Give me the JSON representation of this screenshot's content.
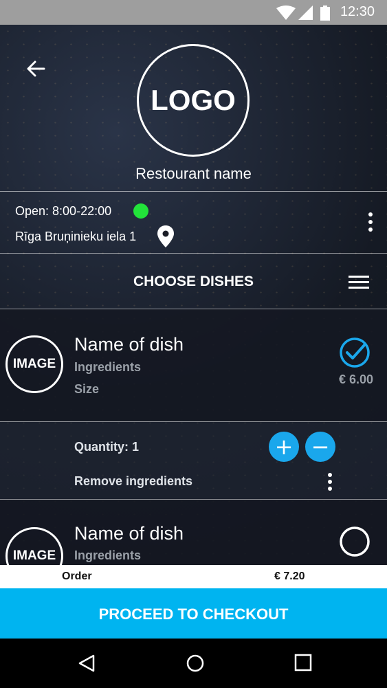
{
  "status": {
    "time": "12:30"
  },
  "header": {
    "logo_text": "LOGO",
    "restaurant_name": "Restourant name"
  },
  "info": {
    "open_hours": "Open: 8:00-22:00",
    "address": "Rīga Bruņinieku iela 1",
    "open_status_color": "#22e33a"
  },
  "section": {
    "title": "CHOOSE DISHES"
  },
  "dishes": [
    {
      "image_label": "IMAGE",
      "name": "Name of dish",
      "ingredients": "Ingredients",
      "size": "Size",
      "price": "€ 6.00",
      "selected": true
    },
    {
      "image_label": "IMAGE",
      "name": "Name of dish",
      "ingredients": "Ingredients",
      "selected": false
    }
  ],
  "quantity": {
    "label": "Quantity: 1",
    "remove_label": "Remove ingredients",
    "plus": "+",
    "minus": "−"
  },
  "order": {
    "label": "Order",
    "total": "€ 7.20"
  },
  "checkout": {
    "label": "PROCEED TO CHECKOUT"
  },
  "colors": {
    "accent": "#00b4f0",
    "button": "#1aa7ec"
  }
}
